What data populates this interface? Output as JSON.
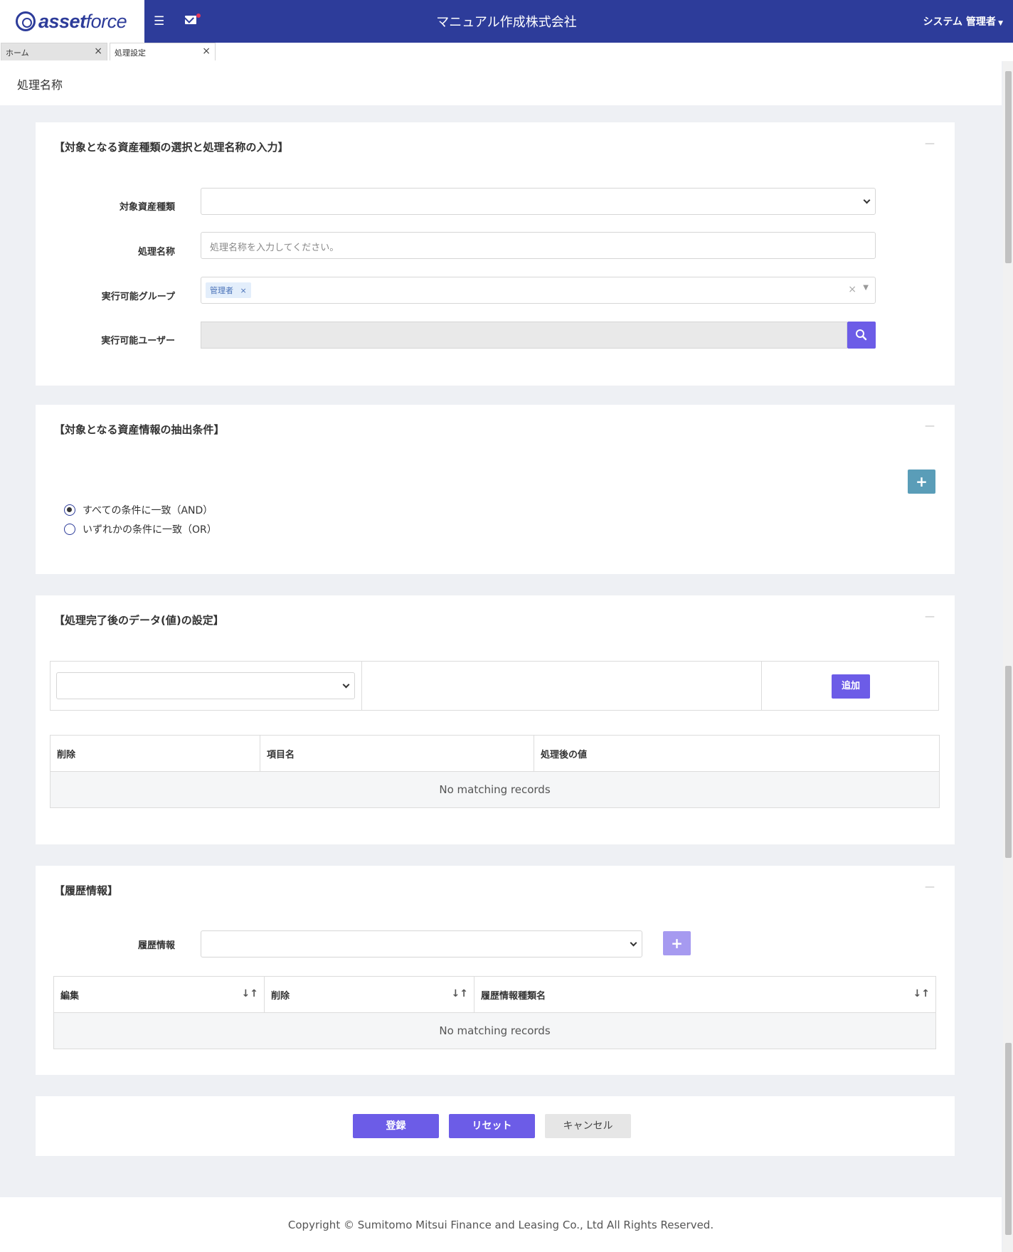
{
  "header": {
    "logo_bold": "asset",
    "logo_light": "force",
    "company_name": "マニュアル作成株式会社",
    "user_menu": "システム 管理者",
    "menu_icon": "hamburger-icon",
    "mail_icon": "mail-icon"
  },
  "tabs": [
    {
      "label": "ホーム",
      "close": "×"
    },
    {
      "label": "処理設定",
      "close": "×"
    }
  ],
  "page_title": "処理名称",
  "section1": {
    "title": "【対象となる資産種類の選択と処理名称の入力】",
    "collapse": "—",
    "asset_type_label": "対象資産種類",
    "asset_type_value": "",
    "process_name_label": "処理名称",
    "process_name_placeholder": "処理名称を入力してください。",
    "group_label": "実行可能グループ",
    "group_tag": "管理者",
    "group_tag_remove": "×",
    "group_clear": "×",
    "user_label": "実行可能ユーザー",
    "search_icon": "search-icon"
  },
  "section2": {
    "title": "【対象となる資産情報の抽出条件】",
    "collapse": "—",
    "add_icon": "+",
    "option_and": "すべての条件に一致（AND）",
    "option_or": "いずれかの条件に一致（OR）",
    "selected": "and"
  },
  "section3": {
    "title": "【処理完了後のデータ(値)の設定】",
    "collapse": "—",
    "add_button": "追加",
    "columns": [
      "削除",
      "項目名",
      "処理後の値"
    ],
    "empty_text": "No matching records"
  },
  "section4": {
    "title": "【履歴情報】",
    "collapse": "—",
    "history_label": "履歴情報",
    "add_icon": "+",
    "columns": [
      "編集",
      "削除",
      "履歴情報種類名"
    ],
    "sort_icon": "↓↑",
    "empty_text": "No matching records"
  },
  "actions": {
    "register": "登録",
    "reset": "リセット",
    "cancel": "キャンセル"
  },
  "footer": {
    "copyright": "Copyright © Sumitomo Mitsui Finance and Leasing Co., Ltd All Rights Reserved."
  },
  "colors": {
    "brand": "#2d3c9a",
    "accent": "#6c5ce7",
    "teal": "#5a9db8"
  }
}
